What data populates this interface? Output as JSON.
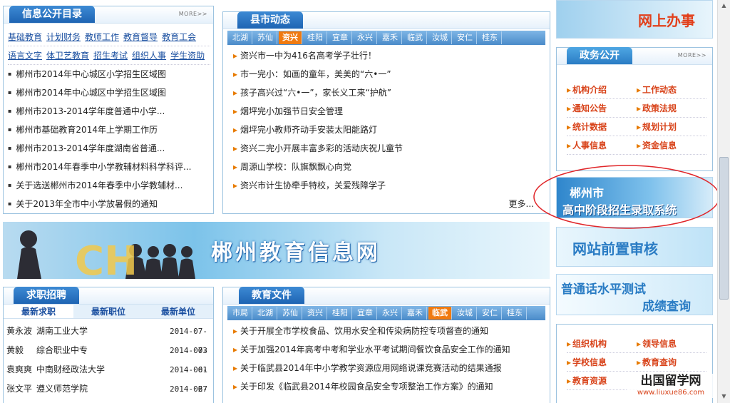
{
  "catalog": {
    "title": "信息公开目录",
    "more": "MORE>>",
    "links_row1": [
      "基础教育",
      "计划财务",
      "教师工作",
      "教育督导",
      "教育工会"
    ],
    "links_row2": [
      "语言文字",
      "体卫艺教育",
      "招生考试",
      "组织人事",
      "学生资助"
    ],
    "items": [
      "郴州市2014年中心城区小学招生区域图",
      "郴州市2014年中心城区中学招生区域图",
      "郴州市2013-2014学年度普通中小学...",
      "郴州市基础教育2014年上学期工作历",
      "郴州市2013-2014学年度湖南省普通...",
      "郴州市2014年春季中小学教辅材料科学科评...",
      "关于选送郴州市2014年春季中小学教辅材...",
      "关于2013年全市中小学放暑假的通知"
    ]
  },
  "county": {
    "title": "县市动态",
    "tabs": [
      "北湖",
      "苏仙",
      "资兴",
      "桂阳",
      "宜章",
      "永兴",
      "嘉禾",
      "临武",
      "汝城",
      "安仁",
      "桂东"
    ],
    "active_tab": "资兴",
    "items": [
      "资兴市一中为416名高考学子壮行！",
      "市一完小：如画的童年，美美的“六•一”",
      "孩子高兴过“六•一”，家长义工来“护航”",
      "烟坪完小加强节日安全管理",
      "烟坪完小教师齐动手安装太阳能路灯",
      "资兴二完小开展丰富多彩的活动庆祝儿童节",
      "周源山学校：队旗飘飘心向党",
      "资兴市计生协牵手特校，关爱残障学子"
    ],
    "more": "更多..."
  },
  "banner": {
    "title": "郴州教育信息网"
  },
  "jobs": {
    "title": "求职招聘",
    "tabs": [
      "最新求职",
      "最新职位",
      "最新单位"
    ],
    "rows": [
      {
        "name": "黄永波",
        "school": "湖南工业大学",
        "date": "2014-07-03"
      },
      {
        "name": "黄毅",
        "school": "综合职业中专",
        "date": "2014-07-01"
      },
      {
        "name": "袁爽爽",
        "school": "中南财经政法大学",
        "date": "2014-06-27"
      },
      {
        "name": "张文平",
        "school": "遵义师范学院",
        "date": "2014-06-01"
      }
    ]
  },
  "docs": {
    "title": "教育文件",
    "tabs": [
      "市局",
      "北湖",
      "苏仙",
      "资兴",
      "桂阳",
      "宜章",
      "永兴",
      "嘉禾",
      "临武",
      "汝城",
      "安仁",
      "桂东"
    ],
    "active_tab": "临武",
    "items": [
      "关于开展全市学校食品、饮用水安全和传染病防控专项督查的通知",
      "关于加强2014年高考中考和学业水平考试期间餐饮食品安全工作的通知",
      "关于临武县2014年中小学教学资源应用网络说课竞赛活动的结果通报",
      "关于印发《临武县2014年校园食品安全专项整治工作方案》的通知"
    ]
  },
  "right": {
    "online": "网上办事",
    "gov_title": "政务公开",
    "gov_more": "MORE>>",
    "gov_links": [
      "机构介绍",
      "工作动态",
      "通知公告",
      "政策法规",
      "统计数据",
      "规划计划",
      "人事信息",
      "资金信息"
    ],
    "enroll_line1": "郴州市",
    "enroll_line2": "高中阶段招生录取系统",
    "review": "网站前置审核",
    "mandarin_line1": "普通话水平测试",
    "mandarin_line2": "成绩查询",
    "bottom_links": [
      "组织机构",
      "领导信息",
      "学校信息",
      "教育查询",
      "教育资源"
    ]
  },
  "watermark": {
    "line1": "出国留学网",
    "line2": "www.liuxue86.com"
  },
  "colors": {
    "accent": "#1e64b3",
    "orange": "#f07a10",
    "link_red": "#d8431a"
  }
}
